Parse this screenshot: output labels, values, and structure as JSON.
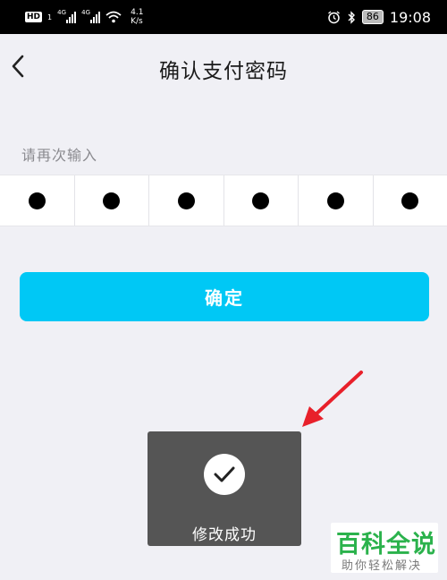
{
  "statusbar": {
    "hd": "HD",
    "sim1": "1",
    "net1": "4G",
    "net2": "4G",
    "speed_value": "4.1",
    "speed_unit": "K/s",
    "battery": "86",
    "time": "19:08"
  },
  "header": {
    "title": "确认支付密码"
  },
  "prompt": "请再次输入",
  "pin": {
    "length": 6,
    "filled": 6
  },
  "confirm_button": "确定",
  "toast": {
    "text": "修改成功"
  },
  "watermark": {
    "main": "百科全说",
    "sub": "助你轻松解决"
  },
  "colors": {
    "accent": "#00c8f5",
    "background": "#f0f0f5",
    "toast": "#555555",
    "arrow": "#e8202a",
    "watermark": "#2bb24c"
  }
}
